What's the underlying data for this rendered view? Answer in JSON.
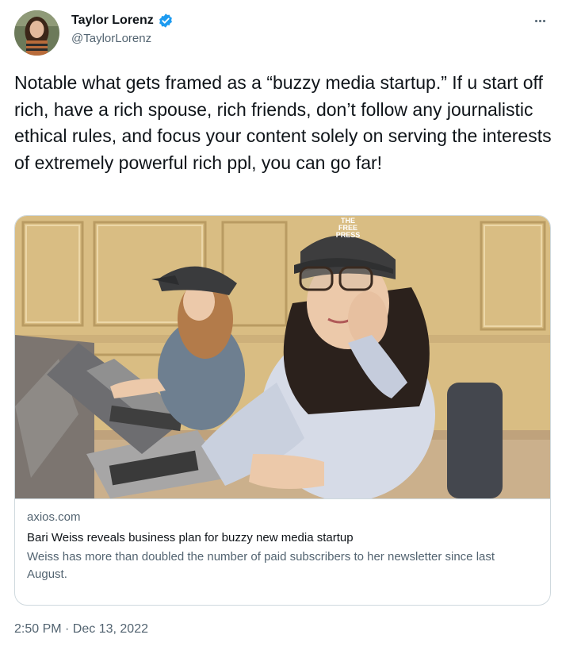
{
  "author": {
    "display_name": "Taylor Lorenz",
    "handle": "@TaylorLorenz",
    "verified_icon": "verified-badge-icon",
    "accent_color": "#1d9bf0"
  },
  "more_icon": "more-horizontal-icon",
  "tweet": {
    "text": "Notable what gets framed as a “buzzy media startup.” If u start off rich, have a rich spouse, rich friends, don’t follow any journalistic ethical rules, and focus your content solely on serving the interests of extremely powerful rich ppl, you can go far!"
  },
  "card": {
    "image_hat_text": [
      "THE",
      "FREE",
      "PRESS"
    ],
    "domain": "axios.com",
    "title": "Bari Weiss reveals business plan for buzzy new media startup",
    "description": "Weiss has more than doubled the number of paid subscribers to her newsletter since last August."
  },
  "timestamp": "2:50 PM · Dec 13, 2022"
}
